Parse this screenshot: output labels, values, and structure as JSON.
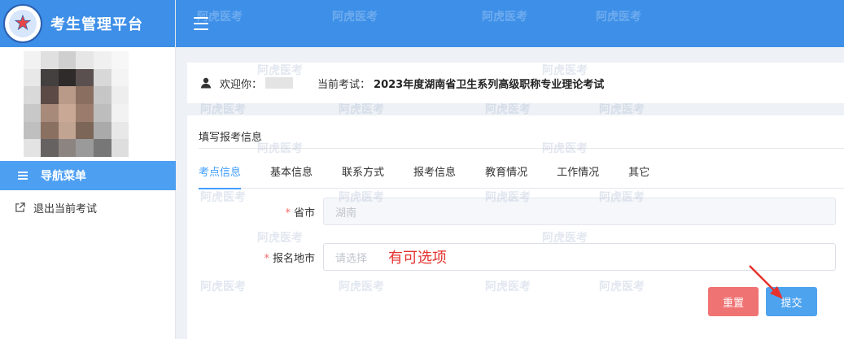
{
  "app": {
    "title": "考生管理平台"
  },
  "sidebar": {
    "nav_header": "导航菜单",
    "items": [
      {
        "label": "退出当前考试",
        "icon": "external-link-icon"
      }
    ]
  },
  "welcome": {
    "greeting": "欢迎你：",
    "exam_label": "当前考试：",
    "exam_name": "2023年度湖南省卫生系列高级职称专业理论考试"
  },
  "form": {
    "title": "填写报考信息",
    "tabs": [
      {
        "label": "考点信息",
        "active": true
      },
      {
        "label": "基本信息",
        "active": false
      },
      {
        "label": "联系方式",
        "active": false
      },
      {
        "label": "报考信息",
        "active": false
      },
      {
        "label": "教育情况",
        "active": false
      },
      {
        "label": "工作情况",
        "active": false
      },
      {
        "label": "其它",
        "active": false
      }
    ],
    "fields": [
      {
        "label": "省市",
        "required": "*",
        "value": "湖南"
      },
      {
        "label": "报名地市",
        "required": "*",
        "placeholder": "请选择"
      }
    ],
    "annotation": "有可选项",
    "buttons": {
      "reset": "重置",
      "submit": "提交"
    }
  },
  "watermark": "阿虎医考",
  "colors": {
    "primary": "#3d8fe8",
    "nav_header": "#4d9ff2",
    "reset": "#f07373",
    "submit": "#4ea3ef",
    "annotation": "#e5322d"
  }
}
